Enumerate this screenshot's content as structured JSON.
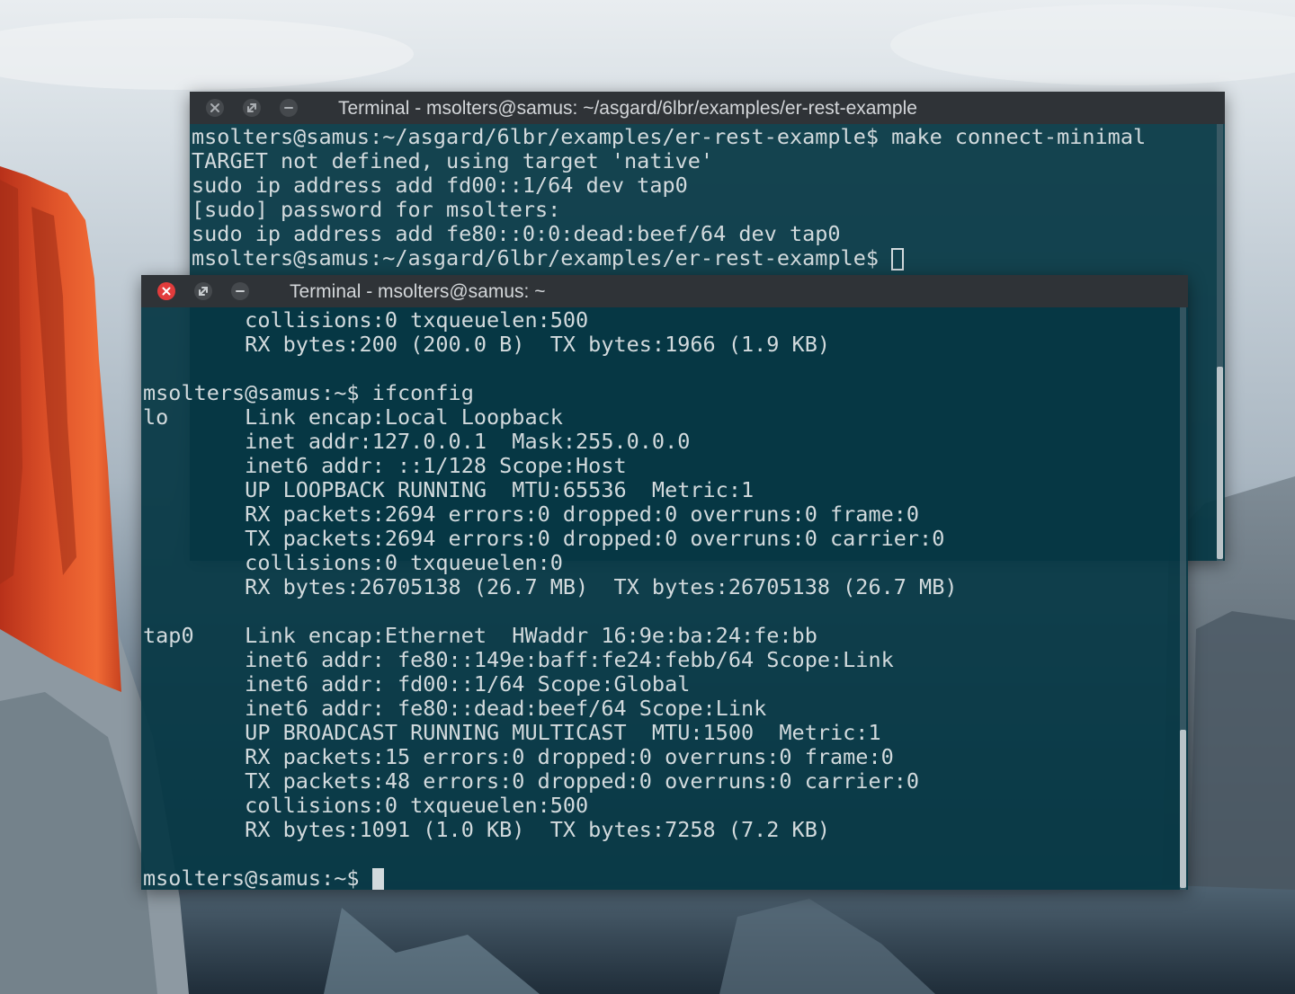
{
  "background_window": {
    "title": "Terminal - msolters@samus: ~/asgard/6lbr/examples/er-rest-example",
    "lines": [
      "msolters@samus:~/asgard/6lbr/examples/er-rest-example$ make connect-minimal",
      "TARGET not defined, using target 'native'",
      "sudo ip address add fd00::1/64 dev tap0",
      "[sudo] password for msolters:",
      "sudo ip address add fe80::0:0:dead:beef/64 dev tap0"
    ],
    "prompt": "msolters@samus:~/asgard/6lbr/examples/er-rest-example$ "
  },
  "foreground_window": {
    "title": "Terminal - msolters@samus: ~",
    "lines": [
      "        collisions:0 txqueuelen:500",
      "        RX bytes:200 (200.0 B)  TX bytes:1966 (1.9 KB)",
      "",
      "msolters@samus:~$ ifconfig",
      "lo      Link encap:Local Loopback",
      "        inet addr:127.0.0.1  Mask:255.0.0.0",
      "        inet6 addr: ::1/128 Scope:Host",
      "        UP LOOPBACK RUNNING  MTU:65536  Metric:1",
      "        RX packets:2694 errors:0 dropped:0 overruns:0 frame:0",
      "        TX packets:2694 errors:0 dropped:0 overruns:0 carrier:0",
      "        collisions:0 txqueuelen:0",
      "        RX bytes:26705138 (26.7 MB)  TX bytes:26705138 (26.7 MB)",
      "",
      "tap0    Link encap:Ethernet  HWaddr 16:9e:ba:24:fe:bb",
      "        inet6 addr: fe80::149e:baff:fe24:febb/64 Scope:Link",
      "        inet6 addr: fd00::1/64 Scope:Global",
      "        inet6 addr: fe80::dead:beef/64 Scope:Link",
      "        UP BROADCAST RUNNING MULTICAST  MTU:1500  Metric:1",
      "        RX packets:15 errors:0 dropped:0 overruns:0 frame:0",
      "        TX packets:48 errors:0 dropped:0 overruns:0 carrier:0",
      "        collisions:0 txqueuelen:500",
      "        RX bytes:1091 (1.0 KB)  TX bytes:7258 (7.2 KB)",
      ""
    ],
    "prompt": "msolters@samus:~$ "
  },
  "colors": {
    "titlebar": "#2f3337",
    "terminal_bg": "#053744",
    "terminal_fg": "#d2dadd",
    "close_active": "#e23c3c"
  },
  "icons": {
    "close": "close-icon",
    "maximize": "maximize-icon",
    "minimize": "minimize-icon"
  }
}
